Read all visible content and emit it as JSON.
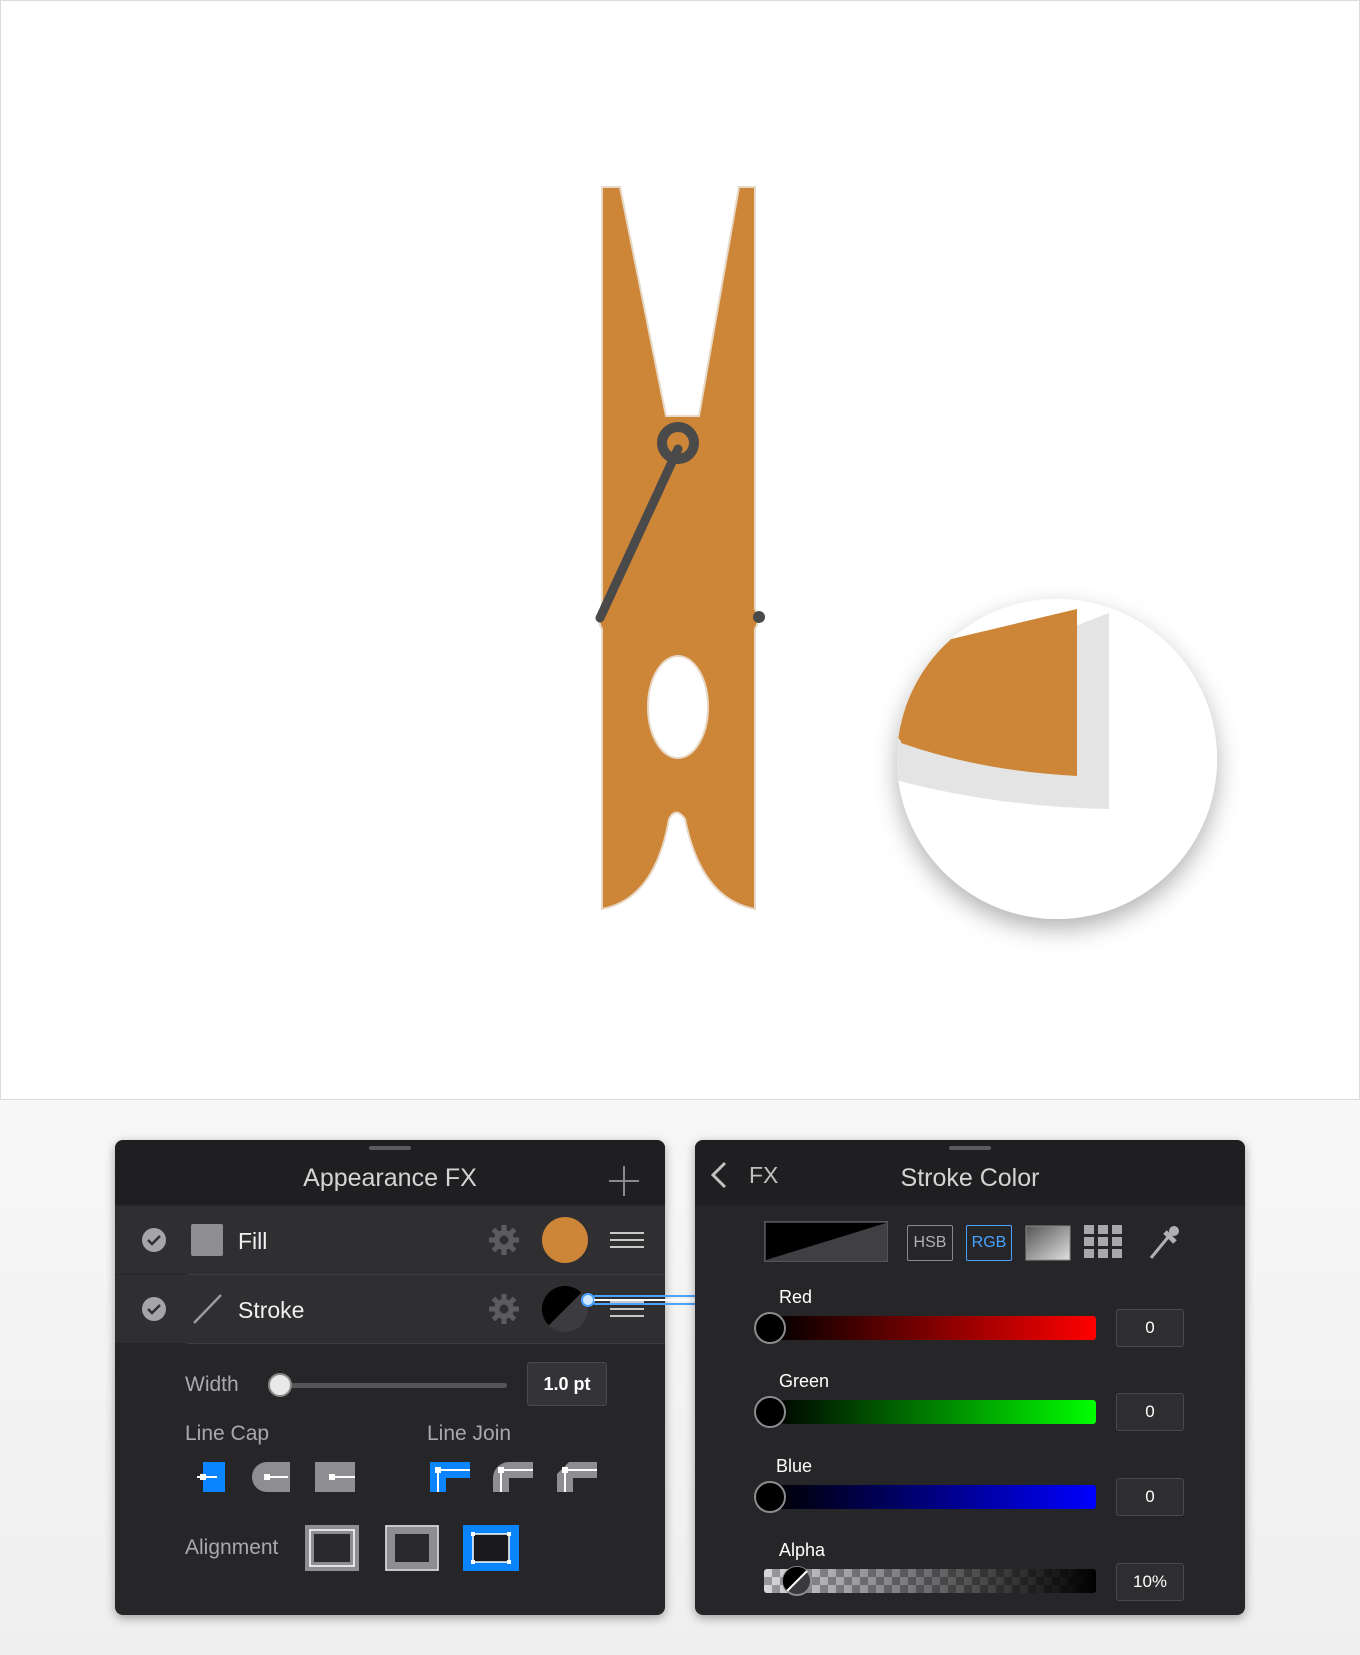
{
  "appearance_panel": {
    "title": "Appearance FX",
    "add_icon": "plus-icon",
    "items": [
      {
        "label": "Fill",
        "enabled": true,
        "icon": "fill-square-icon",
        "swatch_color": "#cd8637"
      },
      {
        "label": "Stroke",
        "enabled": true,
        "icon": "stroke-line-icon",
        "swatch_color": "#000000"
      }
    ],
    "width": {
      "label": "Width",
      "value": "1.0 pt",
      "level": 0.05
    },
    "line_cap": {
      "label": "Line Cap",
      "options": [
        "butt-cap",
        "round-cap",
        "square-cap"
      ],
      "selected": 0
    },
    "line_join": {
      "label": "Line Join",
      "options": [
        "miter-join",
        "round-join",
        "bevel-join"
      ],
      "selected": 0
    },
    "alignment": {
      "label": "Alignment",
      "options": [
        "inside",
        "center",
        "outside"
      ],
      "selected": 2
    }
  },
  "stroke_color_panel": {
    "back_label": "FX",
    "title": "Stroke Color",
    "modes": [
      "HSB",
      "RGB"
    ],
    "selected_mode": "RGB",
    "channels": [
      {
        "label": "Red",
        "value": "0",
        "level": 0,
        "color": "#ff0000"
      },
      {
        "label": "Green",
        "value": "0",
        "level": 0,
        "color": "#00ff00"
      },
      {
        "label": "Blue",
        "value": "0",
        "level": 0,
        "color": "#0000ff"
      },
      {
        "label": "Alpha",
        "value": "10%",
        "level": 0.1
      }
    ]
  },
  "colors": {
    "clothespin": "#cd8637",
    "spring": "#4a4a4a",
    "accent": "#0a7cff"
  }
}
